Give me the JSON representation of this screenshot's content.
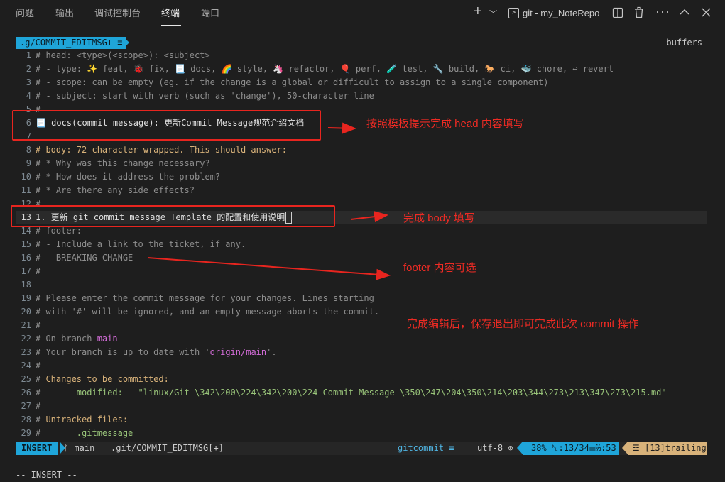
{
  "panel": {
    "tabs": [
      "问题",
      "输出",
      "调试控制台",
      "终端",
      "端口"
    ],
    "active_tab": "终端",
    "terminal_name": "git - my_NoteRepo",
    "icons": [
      "add-icon",
      "chevron-down-icon",
      "terminal-icon",
      "split-icon",
      "trash-icon",
      "more-icon",
      "chevron-up-icon",
      "close-icon"
    ]
  },
  "tabline": {
    "buffer": ".g/COMMIT_EDITMSG+ ≡",
    "right": "buffers"
  },
  "lines": [
    {
      "n": "1",
      "t": "# head: <type>(<scope>): <subject>"
    },
    {
      "n": "2",
      "t": "# - type: ✨ feat, 🐞 fix, 📃 docs, 🌈 style, 🦄 refactor, 🎈 perf, 🧪 test, 🔧 build, 🐎 ci, 🐳 chore, ↩ revert"
    },
    {
      "n": "3",
      "t": "# - scope: can be empty (eg. if the change is a global or difficult to assign to a single component)"
    },
    {
      "n": "4",
      "t": "# - subject: start with verb (such as 'change'), 50-character line"
    },
    {
      "n": "5",
      "t": "#"
    },
    {
      "n": "6",
      "t": "📃 docs(commit message): 更新Commit Message规范介绍文档"
    },
    {
      "n": "7",
      "t": ""
    },
    {
      "n": "8",
      "t": "# body: 72-character wrapped. This should answer:"
    },
    {
      "n": "9",
      "t": "# * Why was this change necessary?"
    },
    {
      "n": "10",
      "t": "# * How does it address the problem?"
    },
    {
      "n": "11",
      "t": "# * Are there any side effects?"
    },
    {
      "n": "12",
      "t": "#"
    },
    {
      "n": "13",
      "t": "1. 更新 git commit message Template 的配置和使用说明"
    },
    {
      "n": "14",
      "t": "# footer:"
    },
    {
      "n": "15",
      "t": "# - Include a link to the ticket, if any."
    },
    {
      "n": "16",
      "t": "# - BREAKING CHANGE"
    },
    {
      "n": "17",
      "t": "#"
    },
    {
      "n": "18",
      "t": ""
    },
    {
      "n": "19",
      "t": "# Please enter the commit message for your changes. Lines starting"
    },
    {
      "n": "20",
      "t": "# with '#' will be ignored, and an empty message aborts the commit."
    },
    {
      "n": "21",
      "t": "#"
    },
    {
      "n": "22",
      "t": "# On branch ",
      "hl": "main"
    },
    {
      "n": "23",
      "t": "# Your branch is up to date with '",
      "hl": "origin/main",
      "tail": "'."
    },
    {
      "n": "24",
      "t": "#"
    },
    {
      "n": "25",
      "t": "# ",
      "hl": "Changes to be committed:"
    },
    {
      "n": "26",
      "t": "#       ",
      "hl": "modified:   \"linux/Git \\342\\200\\224\\342\\200\\224 Commit Message \\350\\247\\204\\350\\214\\203\\344\\273\\213\\347\\273\\215.md\""
    },
    {
      "n": "27",
      "t": "#"
    },
    {
      "n": "28",
      "t": "# ",
      "hl": "Untracked files:"
    },
    {
      "n": "29",
      "t": "#       ",
      "hl": ".gitmessage"
    }
  ],
  "statusline": {
    "mode": "INSERT",
    "branch": "ᚴ main",
    "file": ".git/COMMIT_EDITMSG[+]",
    "filetype": "gitcommit ≡",
    "encoding": "utf-8 ⊗",
    "position": "38% ␤:13/34☰℅:53",
    "trailing": "☲ [13]trailing"
  },
  "cmdline": "-- INSERT --",
  "annotations": {
    "head": "按照模板提示完成 head 内容填写",
    "body": "完成 body 填写",
    "footer": "footer 内容可选",
    "done": "完成编辑后，保存退出即可完成此次 commit 操作"
  },
  "colors": {
    "accent": "#1fa5d9",
    "annotation": "#e8251f",
    "trailing": "#d8b27a"
  }
}
